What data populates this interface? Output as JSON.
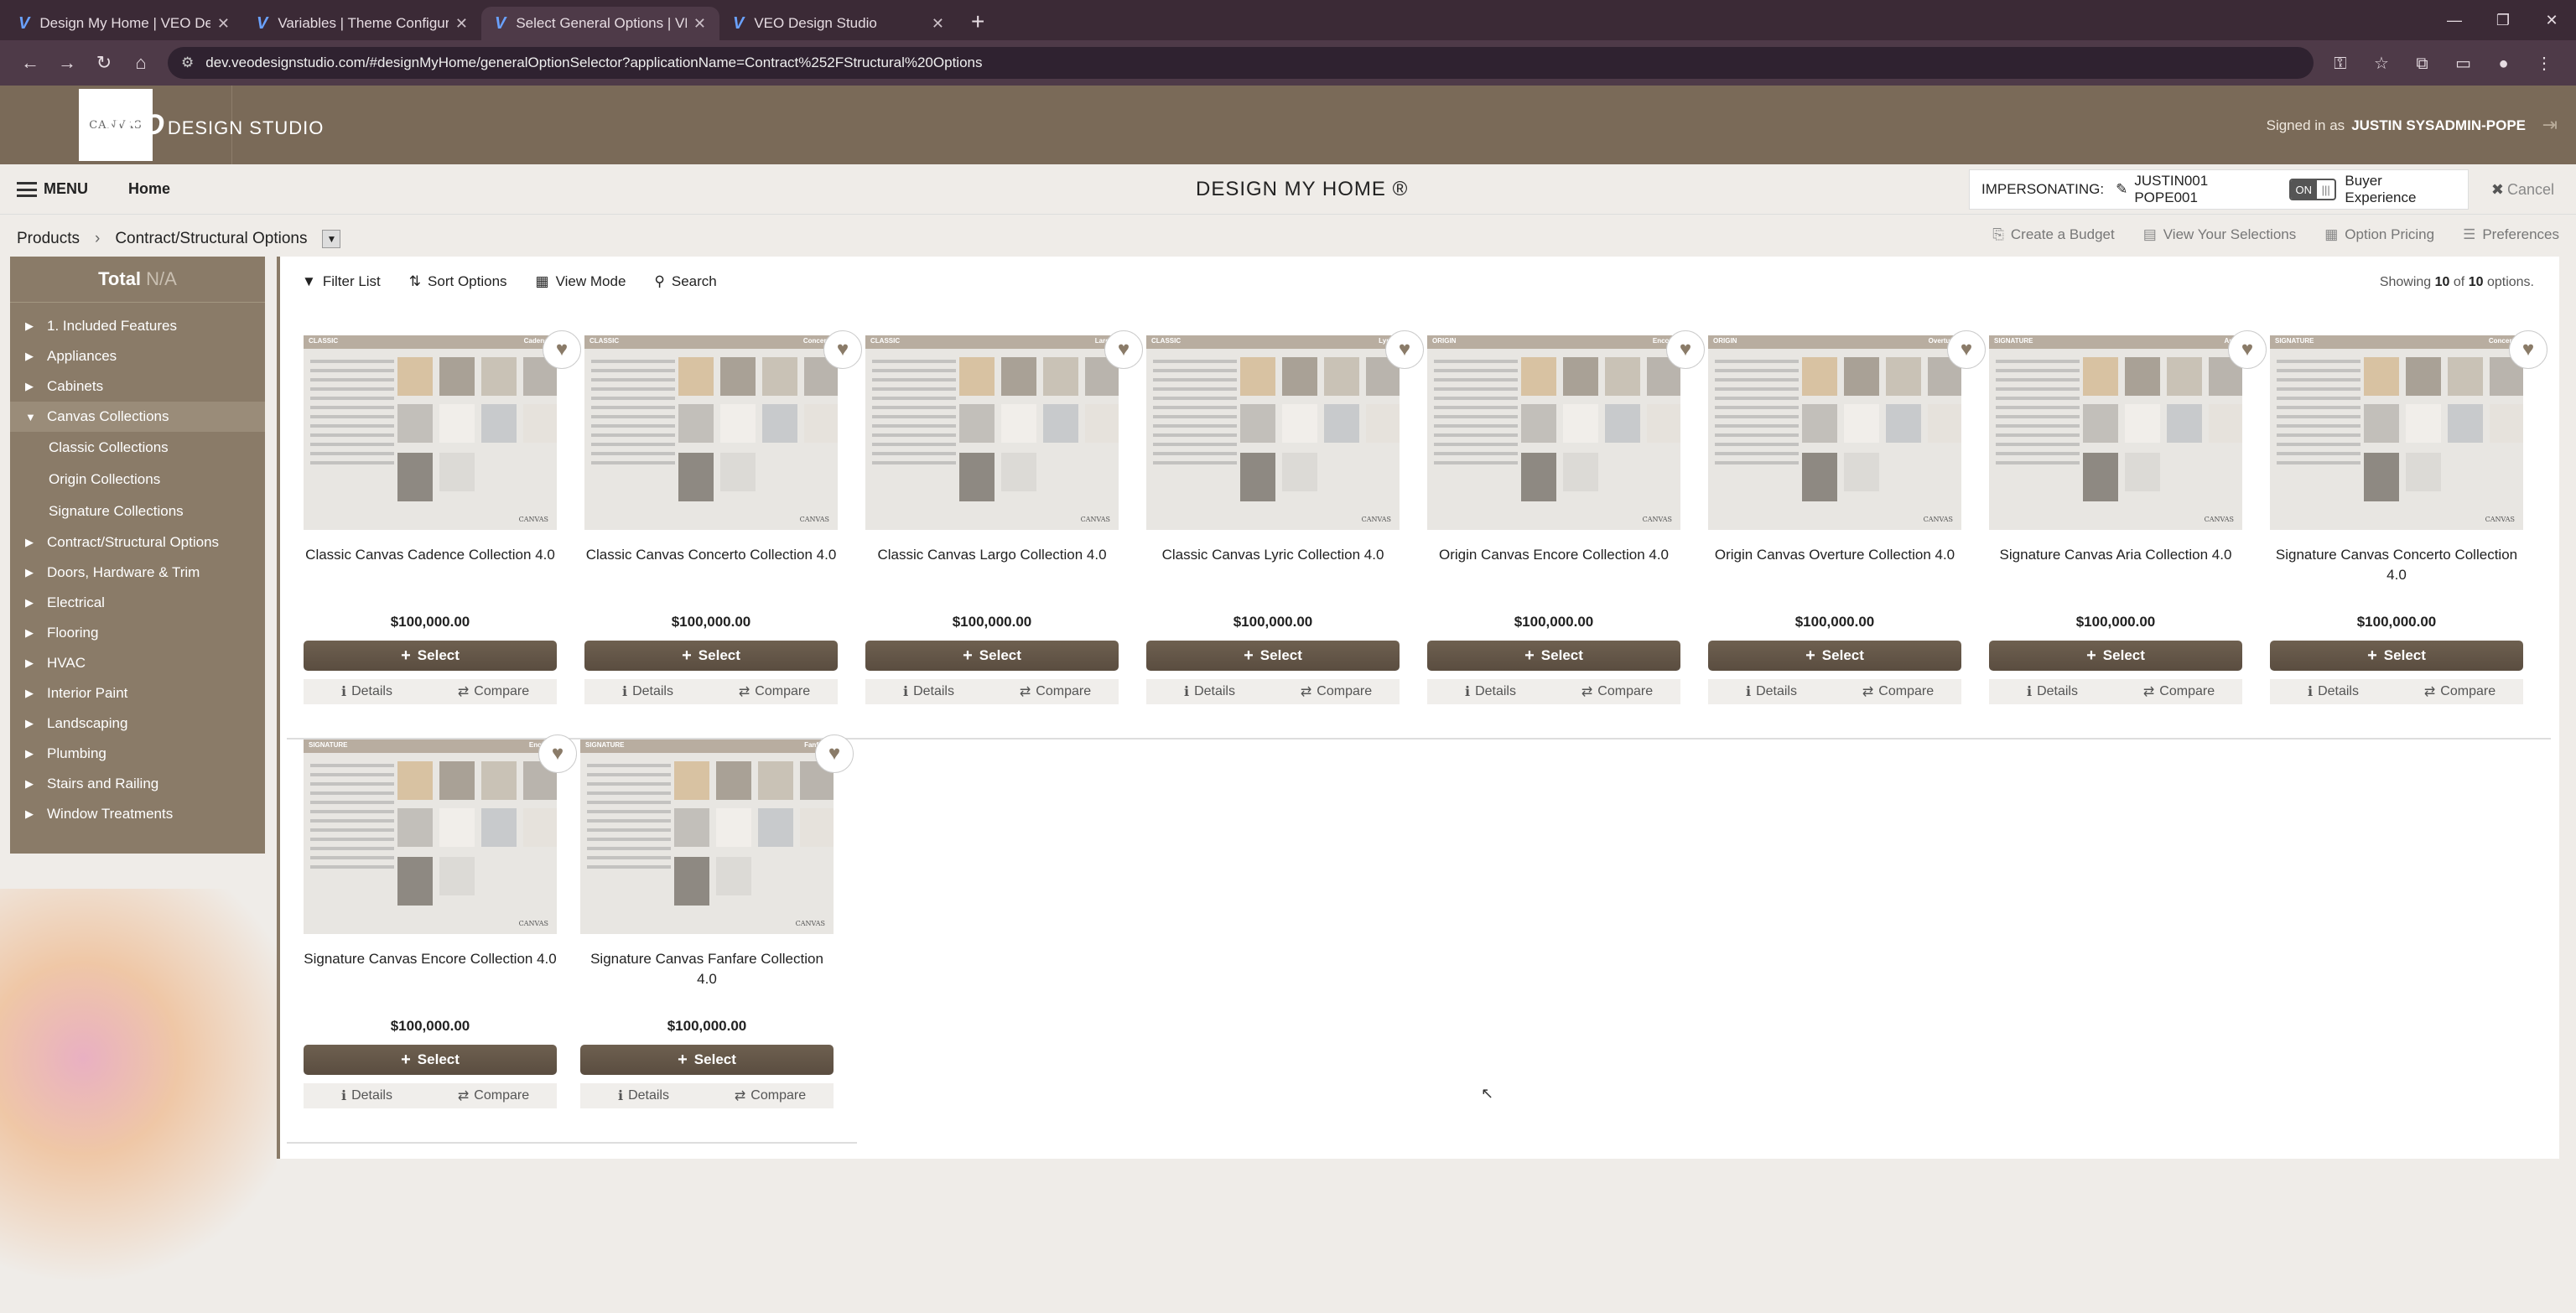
{
  "browser": {
    "tabs": [
      {
        "title": "Design My Home | VEO Design",
        "active": false
      },
      {
        "title": "Variables | Theme Configuration",
        "active": false
      },
      {
        "title": "Select General Options | VEO D",
        "active": true
      },
      {
        "title": "VEO Design Studio",
        "active": false
      }
    ],
    "url": "dev.veodesignstudio.com/#designMyHome/generalOptionSelector?applicationName=Contract%252FStructural%20Options"
  },
  "header": {
    "logo_text": "CANVAS",
    "brand_veo": "VEO",
    "brand_sub": "DESIGN STUDIO",
    "signed_in_label": "Signed in as",
    "signed_in_user": "JUSTIN SYSADMIN-POPE"
  },
  "navbar": {
    "menu_label": "MENU",
    "home_label": "Home",
    "title": "DESIGN MY HOME ®",
    "impersonating_label": "IMPERSONATING:",
    "impersonating_user": "JUSTIN001 POPE001",
    "toggle_on": "ON",
    "buyer_experience": "Buyer Experience",
    "cancel_label": "Cancel"
  },
  "breadcrumb": {
    "products": "Products",
    "current": "Contract/Structural Options"
  },
  "right_tools": {
    "create_budget": "Create a Budget",
    "view_selections": "View Your Selections",
    "option_pricing": "Option Pricing",
    "preferences": "Preferences"
  },
  "sidebar": {
    "total_label": "Total",
    "total_value": "N/A",
    "items": [
      {
        "label": "1. Included Features",
        "expanded": false
      },
      {
        "label": "Appliances",
        "expanded": false
      },
      {
        "label": "Cabinets",
        "expanded": false
      },
      {
        "label": "Canvas Collections",
        "expanded": true
      },
      {
        "label": "Classic Collections",
        "sub": true
      },
      {
        "label": "Origin Collections",
        "sub": true
      },
      {
        "label": "Signature Collections",
        "sub": true
      },
      {
        "label": "Contract/Structural Options",
        "expanded": false
      },
      {
        "label": "Doors, Hardware & Trim",
        "expanded": false
      },
      {
        "label": "Electrical",
        "expanded": false
      },
      {
        "label": "Flooring",
        "expanded": false
      },
      {
        "label": "HVAC",
        "expanded": false
      },
      {
        "label": "Interior Paint",
        "expanded": false
      },
      {
        "label": "Landscaping",
        "expanded": false
      },
      {
        "label": "Plumbing",
        "expanded": false
      },
      {
        "label": "Stairs and Railing",
        "expanded": false
      },
      {
        "label": "Window Treatments",
        "expanded": false
      }
    ]
  },
  "content_toolbar": {
    "filter": "Filter List",
    "sort": "Sort Options",
    "view_mode": "View Mode",
    "search": "Search",
    "showing_prefix": "Showing",
    "showing_count": "10",
    "showing_of": "of",
    "showing_total": "10",
    "showing_suffix": "options."
  },
  "card_labels": {
    "select": "Select",
    "details": "Details",
    "compare": "Compare"
  },
  "products": [
    {
      "name": "Classic Canvas Cadence Collection 4.0",
      "price": "$100,000.00",
      "tag": "CLASSIC",
      "tag2": "Cadence"
    },
    {
      "name": "Classic Canvas Concerto Collection 4.0",
      "price": "$100,000.00",
      "tag": "CLASSIC",
      "tag2": "Concerto"
    },
    {
      "name": "Classic Canvas Largo Collection 4.0",
      "price": "$100,000.00",
      "tag": "CLASSIC",
      "tag2": "Largo"
    },
    {
      "name": "Classic Canvas Lyric Collection 4.0",
      "price": "$100,000.00",
      "tag": "CLASSIC",
      "tag2": "Lyric"
    },
    {
      "name": "Origin Canvas Encore Collection 4.0",
      "price": "$100,000.00",
      "tag": "ORIGIN",
      "tag2": "Encore"
    },
    {
      "name": "Origin Canvas Overture Collection 4.0",
      "price": "$100,000.00",
      "tag": "ORIGIN",
      "tag2": "Overture"
    },
    {
      "name": "Signature Canvas Aria Collection 4.0",
      "price": "$100,000.00",
      "tag": "SIGNATURE",
      "tag2": "Aria"
    },
    {
      "name": "Signature Canvas Concerto Collection 4.0",
      "price": "$100,000.00",
      "tag": "SIGNATURE",
      "tag2": "Concerto"
    },
    {
      "name": "Signature Canvas Encore Collection 4.0",
      "price": "$100,000.00",
      "tag": "SIGNATURE",
      "tag2": "Encore"
    },
    {
      "name": "Signature Canvas Fanfare Collection 4.0",
      "price": "$100,000.00",
      "tag": "SIGNATURE",
      "tag2": "Fanfare"
    }
  ],
  "colors": {
    "header_bg": "#7a6a58",
    "sidebar_bg": "#8a7b68",
    "select_btn": "#5f5245",
    "browser_chrome": "#3b2a36"
  }
}
